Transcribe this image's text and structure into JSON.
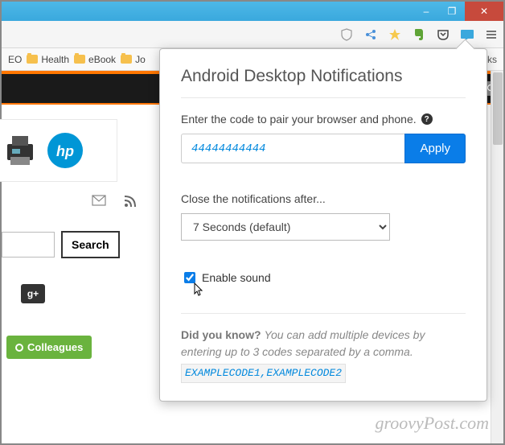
{
  "window": {
    "minimize": "–",
    "restore": "❐",
    "close": "✕"
  },
  "bookmarks": {
    "item1": "EO",
    "item2": "Health",
    "item3": "eBook",
    "item4": "Jo",
    "overflow": "marks"
  },
  "page": {
    "hp_alt": "hp",
    "search_button": "Search",
    "gplus": "g+",
    "colleagues": "Colleagues"
  },
  "popup": {
    "title": "Android Desktop Notifications",
    "pair_label": "Enter the code to pair your browser and phone.",
    "code_value": "44444444444",
    "apply": "Apply",
    "close_label": "Close the notifications after...",
    "close_value": "7 Seconds (default)",
    "sound_label": "Enable sound",
    "didyou_title": "Did you know?",
    "didyou_text": "You can add multiple devices by entering up to 3 codes separated by a comma.",
    "example": "EXAMPLECODE1,EXAMPLECODE2"
  },
  "watermark": "groovyPost.com"
}
